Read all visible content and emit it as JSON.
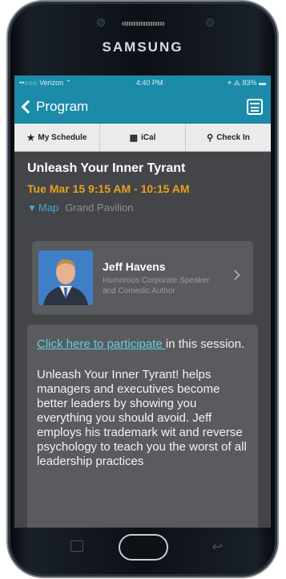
{
  "device": {
    "brand": "SAMSUNG"
  },
  "status_bar": {
    "carrier": "••○○○ Verizon ⌃",
    "time": "4:40 PM",
    "battery": "⌖ ⁂ 83% ▬"
  },
  "nav": {
    "back_label": "Program",
    "calendar_icon": "calendar-icon"
  },
  "actions": [
    {
      "icon": "★",
      "icon_name": "star-icon",
      "label": "My Schedule"
    },
    {
      "icon": "▦",
      "icon_name": "calendar-icon",
      "label": "iCal"
    },
    {
      "icon": "⚲",
      "icon_name": "person-pin-icon",
      "label": "Check In"
    }
  ],
  "session": {
    "title": "Unleash Your Inner Tyrant",
    "datetime": "Tue Mar 15 9:15 AM - 10:15 AM",
    "map_label": "Map",
    "venue": "Grand Pavilion"
  },
  "speaker": {
    "name": "Jeff Havens",
    "description": "Humorous Corporate Speaker and Comedic Author"
  },
  "description": {
    "link_text": "Click here to participate ",
    "after_link": "in this session.",
    "body": "Unleash Your Inner Tyrant! helps managers and executives become better leaders by showing you everything you should avoid. Jeff employs his trademark wit and reverse psychology to teach you the worst of all leadership practices"
  },
  "colors": {
    "accent": "#1c8aa9",
    "time": "#e6a21d",
    "link": "#5fd0e0"
  }
}
